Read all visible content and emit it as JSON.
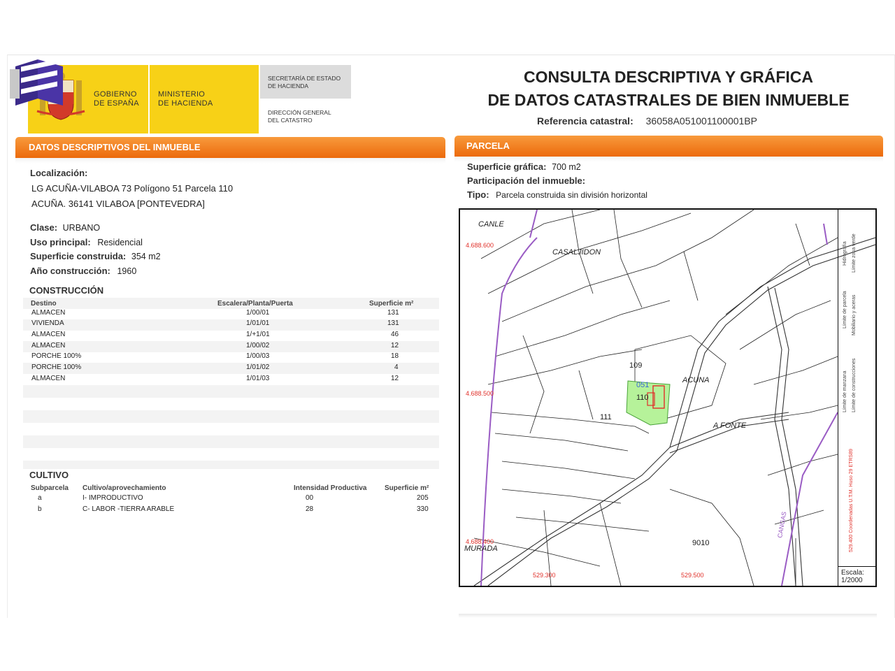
{
  "header": {
    "gobierno": [
      "GOBIERNO",
      "DE ESPAÑA"
    ],
    "ministerio": [
      "MINISTERIO",
      "DE HACIENDA"
    ],
    "secretaria": [
      "SECRETARÍA DE ESTADO",
      "DE HACIENDA"
    ],
    "direccion": [
      "DIRECCIÓN GENERAL",
      "DEL CATASTRO"
    ],
    "title_line1": "CONSULTA DESCRIPTIVA Y GRÁFICA",
    "title_line2": "DE DATOS CATASTRALES DE BIEN INMUEBLE",
    "ref_label": "Referencia catastral:",
    "ref_value": "36058A051001100001BP"
  },
  "descriptivos": {
    "heading": "DATOS DESCRIPTIVOS DEL INMUEBLE",
    "localizacion_label": "Localización:",
    "localizacion_line1": "LG ACUÑA-VILABOA 73 Polígono 51 Parcela 110",
    "localizacion_line2": "ACUÑA. 36141 VILABOA [PONTEVEDRA]",
    "clase_label": "Clase:",
    "clase_value": "URBANO",
    "uso_label": "Uso principal:",
    "uso_value": "Residencial",
    "superficie_label": "Superficie construida:",
    "superficie_value": "354 m2",
    "anio_label": "Año construcción:",
    "anio_value": "1960"
  },
  "construccion": {
    "heading": "CONSTRUCCIÓN",
    "headers": [
      "Destino",
      "Escalera/Planta/Puerta",
      "Superficie m²"
    ],
    "rows": [
      [
        "ALMACEN",
        "1/00/01",
        "131"
      ],
      [
        "VIVIENDA",
        "1/01/01",
        "131"
      ],
      [
        "ALMACEN",
        "1/+1/01",
        "46"
      ],
      [
        "ALMACEN",
        "1/00/02",
        "12"
      ],
      [
        "PORCHE 100%",
        "1/00/03",
        "18"
      ],
      [
        "PORCHE 100%",
        "1/01/02",
        "4"
      ],
      [
        "ALMACEN",
        "1/01/03",
        "12"
      ]
    ]
  },
  "cultivo": {
    "heading": "CULTIVO",
    "headers": [
      "Subparcela",
      "Cultivo/aprovechamiento",
      "Intensidad Productiva",
      "Superficie m²"
    ],
    "rows": [
      [
        "a",
        "I- IMPRODUCTIVO",
        "00",
        "205"
      ],
      [
        "b",
        "C- LABOR -TIERRA ARABLE",
        "28",
        "330"
      ]
    ]
  },
  "parcela": {
    "heading": "PARCELA",
    "superficie_label": "Superficie gráfica:",
    "superficie_value": "700 m2",
    "participacion_label": "Participación del inmueble:",
    "tipo_label": "Tipo:",
    "tipo_value": "Parcela construida sin división horizontal"
  },
  "map": {
    "labels": {
      "canle": "CANLE",
      "casaljidon": "CASALJIDON",
      "acuna": "ACUNA",
      "afonte": "A FONTE",
      "murada": "MURADA",
      "cangas": "CANGAS",
      "p109": "109",
      "p110": "110",
      "p111": "111",
      "p051": "051",
      "p9010": "9010",
      "y1": "4.688.600",
      "y2": "4.688.500",
      "y3": "4.688.400",
      "x1": "529.300",
      "x2": "529.500"
    },
    "legend": {
      "col1a": "Límite de manzana",
      "col1b": "Límite de parcela",
      "col1c": "Hidrografía",
      "col2a": "Límite de construcciones",
      "col2b": "Mobiliario y aceras",
      "col2c": "Límite zona verde",
      "coords": "529.400 Coordenadas U.T.M. Huso 29 ETRS89"
    },
    "scale_label": "Escala:",
    "scale_value": "1/2000"
  },
  "colors": {
    "orange": "#ec6a0c",
    "yellow": "#f7d117",
    "parcel_green": "#b6f29a",
    "building_red": "#e0302a",
    "hydro_purple": "#9a5cc4"
  }
}
